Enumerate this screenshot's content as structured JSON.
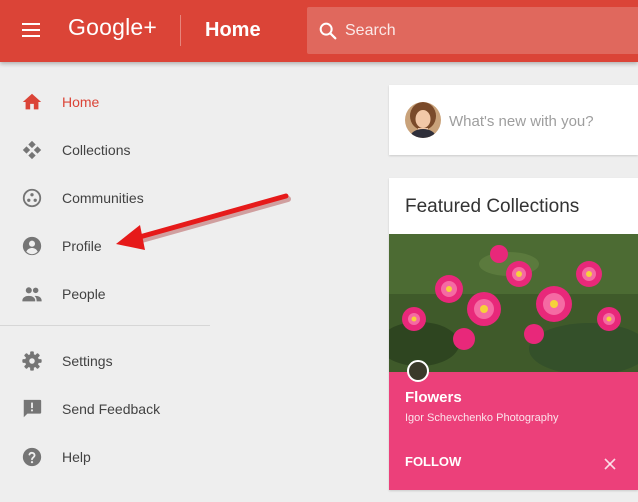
{
  "header": {
    "brand": "Google+",
    "title": "Home",
    "search_placeholder": "Search"
  },
  "sidebar": {
    "items": [
      {
        "label": "Home",
        "icon": "home-icon",
        "active": true
      },
      {
        "label": "Collections",
        "icon": "collections-icon"
      },
      {
        "label": "Communities",
        "icon": "communities-icon"
      },
      {
        "label": "Profile",
        "icon": "profile-icon"
      },
      {
        "label": "People",
        "icon": "people-icon"
      },
      {
        "label": "Settings",
        "icon": "settings-icon"
      },
      {
        "label": "Send Feedback",
        "icon": "feedback-icon"
      },
      {
        "label": "Help",
        "icon": "help-icon"
      }
    ]
  },
  "compose": {
    "placeholder": "What's new with you?"
  },
  "featured": {
    "title": "Featured Collections",
    "collection": {
      "name": "Flowers",
      "owner": "Igor Schevchenko Photography",
      "follow_label": "FOLLOW"
    }
  },
  "colors": {
    "header": "#db4437",
    "active_nav": "#db4437",
    "collection_bg": "#ec407a",
    "annotation_arrow": "#e61a1a"
  }
}
